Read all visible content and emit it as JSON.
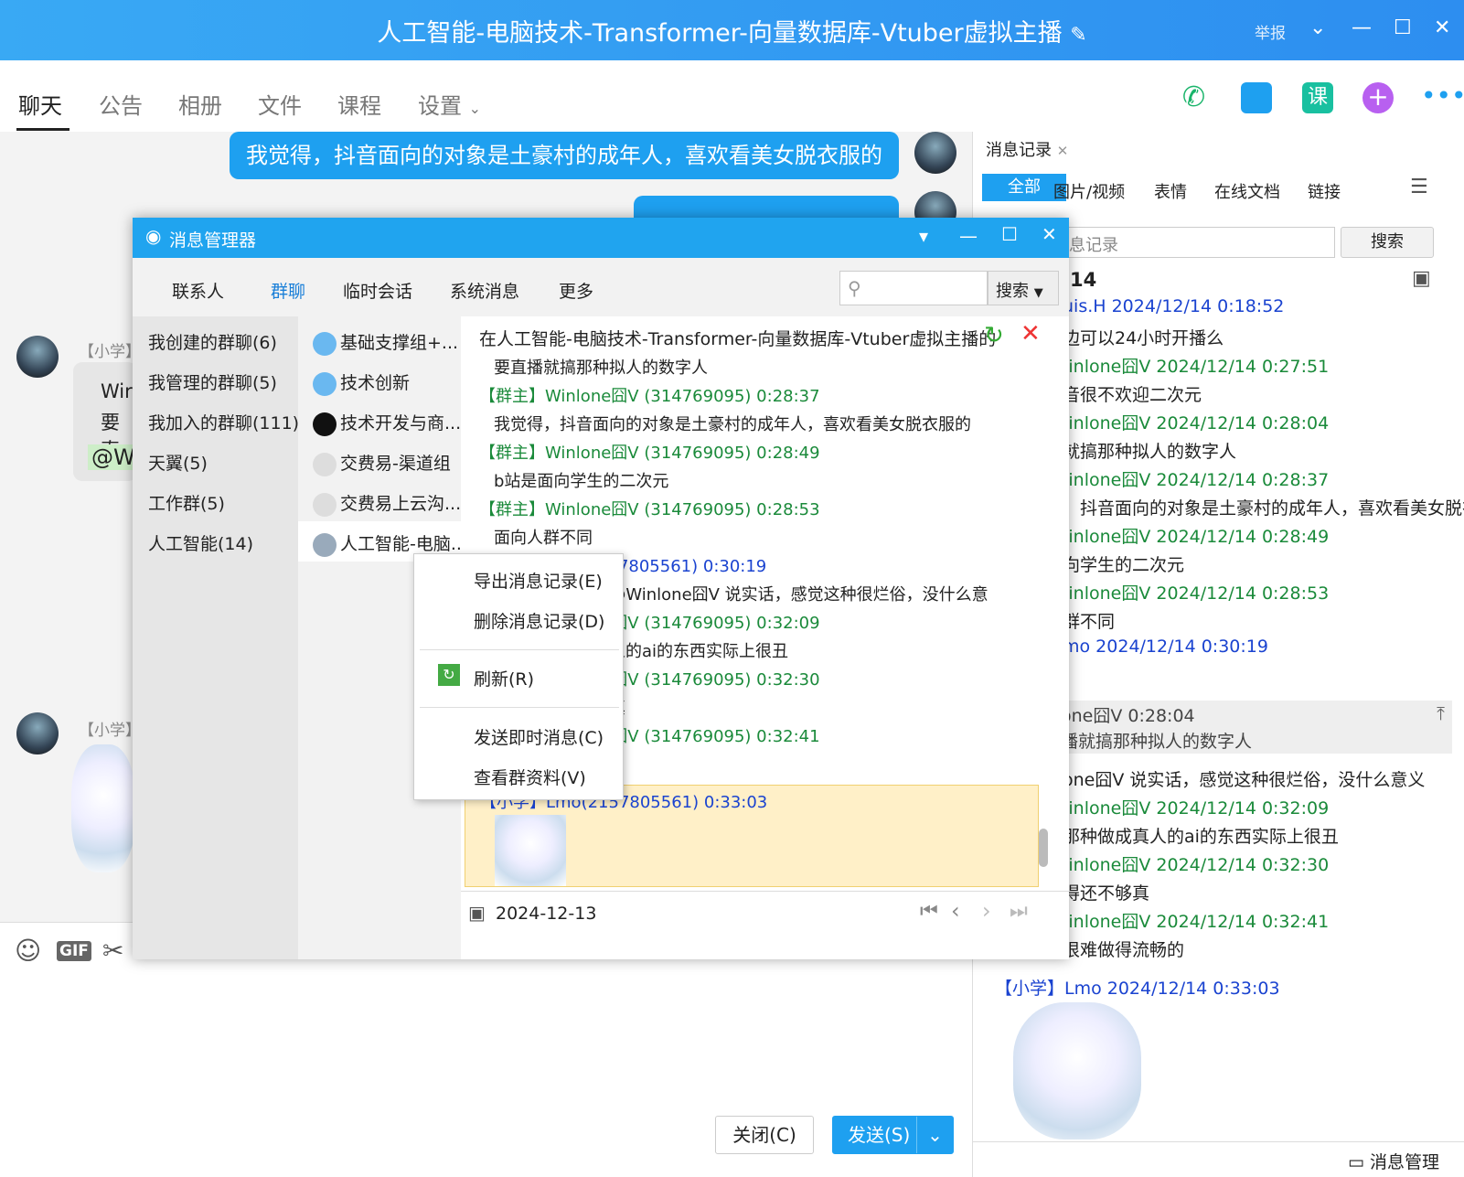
{
  "window": {
    "title": "人工智能-电脑技术-Transformer-向量数据库-Vtuber虚拟主播",
    "report": "举报"
  },
  "tabs": [
    "聊天",
    "公告",
    "相册",
    "文件",
    "课程",
    "设置"
  ],
  "top_icons": [
    "phone-icon",
    "video-icon",
    "course-icon",
    "add-icon",
    "more-icon"
  ],
  "top_icon_text": {
    "course": "课"
  },
  "chat": {
    "bubble1": "我觉得，抖音面向的对象是土豪村的成年人，喜欢看美女脱衣服的",
    "sender_tag": "【小学】",
    "left_bubble_line1": "Wir",
    "left_bubble_line2": "要直",
    "left_bubble_line3": "@W"
  },
  "input": {
    "close_button": "关闭(C)",
    "send_button": "发送(S)",
    "toolbar_icons": [
      "emoji-icon",
      "gif-icon",
      "scissors-icon"
    ],
    "gif_label": "GIF"
  },
  "right_panel": {
    "tab_title": "消息记录",
    "filters": [
      "全部",
      "图片/视频",
      "表情",
      "在线文档",
      "链接"
    ],
    "search_placeholder": "息记录",
    "search_button": "搜索",
    "date_partial": "14",
    "bottom_label": "消息管理",
    "lines": [
      {
        "cls": "b",
        "text": "uis.H 2024/12/14 0:18:52"
      },
      {
        "cls": "",
        "text": "边可以24小时开播么"
      },
      {
        "cls": "g",
        "text": "/inlone囧V  2024/12/14 0:27:51"
      },
      {
        "cls": "",
        "text": "音很不欢迎二次元"
      },
      {
        "cls": "g",
        "text": "/inlone囧V  2024/12/14 0:28:04"
      },
      {
        "cls": "",
        "text": "就搞那种拟人的数字人"
      },
      {
        "cls": "g",
        "text": "/inlone囧V  2024/12/14 0:28:37"
      },
      {
        "cls": "",
        "text": "，抖音面向的对象是土豪村的成年人，喜欢看美女脱衣"
      },
      {
        "cls": "g",
        "text": "/inlone囧V  2024/12/14 0:28:49"
      },
      {
        "cls": "",
        "text": "向学生的二次元"
      },
      {
        "cls": "g",
        "text": "/inlone囧V  2024/12/14 0:28:53"
      },
      {
        "cls": "",
        "text": "群不同"
      },
      {
        "cls": "b",
        "text": "mo 2024/12/14 0:30:19"
      }
    ],
    "quote_name": "one囧V     0:28:04",
    "quote_text": "播就搞那种拟人的数字人",
    "lines2": [
      {
        "cls": "",
        "text": "one囧V  说实话，感觉这种很烂俗，没什么意义"
      },
      {
        "cls": "g",
        "text": "/inlone囧V  2024/12/14 0:32:09"
      },
      {
        "cls": "",
        "text": "那种做成真人的ai的东西实际上很丑"
      },
      {
        "cls": "g",
        "text": "/inlone囧V  2024/12/14 0:32:30"
      },
      {
        "cls": "",
        "text": "得还不够真"
      },
      {
        "cls": "g",
        "text": "/inlone囧V  2024/12/14 0:32:41"
      },
      {
        "cls": "",
        "text": "很难做得流畅的"
      }
    ],
    "last_header": "【小学】Lmo 2024/12/14 0:33:03"
  },
  "message_manager": {
    "title": "消息管理器",
    "nav": [
      "联系人",
      "群聊",
      "临时会话",
      "系统消息",
      "更多"
    ],
    "search_button": "搜索",
    "categories": [
      "我创建的群聊(6)",
      "我管理的群聊(5)",
      "我加入的群聊(111)",
      "天翼(5)",
      "工作群(5)",
      "人工智能(14)"
    ],
    "groups": [
      "基础支撑组+...",
      "技术创新",
      "技术开发与商...",
      "交费易-渠道组",
      "交费易上云沟...",
      "人工智能-电脑..."
    ],
    "header": "在人工智能-电脑技术-Transformer-向量数据库-Vtuber虚拟主播的",
    "messages": [
      {
        "cls": "",
        "text": "要直播就搞那种拟人的数字人"
      },
      {
        "cls": "g",
        "text": "【群主】Winlone囧V (314769095) 0:28:37"
      },
      {
        "cls": "",
        "text": "我觉得，抖音面向的对象是土豪村的成年人，喜欢看美女脱衣服的"
      },
      {
        "cls": "g",
        "text": "【群主】Winlone囧V (314769095) 0:28:49"
      },
      {
        "cls": "",
        "text": "b站是面向学生的二次元"
      },
      {
        "cls": "g",
        "text": "【群主】Winlone囧V (314769095) 0:28:53"
      },
      {
        "cls": "",
        "text": "面向人群不同"
      },
      {
        "cls": "b",
        "text": "【小学】Lmo(2157805561) 0:30:19"
      },
      {
        "cls": "",
        "text": "@Winlone囧V  @Winlone囧V  说实话，感觉这种很烂俗，没什么意"
      },
      {
        "cls": "g",
        "text": "【群主】Winlone囧V (314769095) 0:32:09"
      },
      {
        "cls": "",
        "text": "但是那种做成真人的ai的东西实际上很丑"
      },
      {
        "cls": "g",
        "text": "【群主】Winlone囧V (314769095) 0:32:30"
      },
      {
        "cls": "",
        "text": "就是做得还不够真"
      },
      {
        "cls": "g",
        "text": "【群主】Winlone囧V (314769095) 0:32:41"
      },
      {
        "cls": "",
        "text": "很难做得流畅的"
      }
    ],
    "highlight_header": "【小学】Lmo(2157805561) 0:33:03",
    "date": "2024-12-13"
  },
  "context_menu": [
    "导出消息记录(E)",
    "删除消息记录(D)",
    "刷新(R)",
    "发送即时消息(C)",
    "查看群资料(V)"
  ]
}
